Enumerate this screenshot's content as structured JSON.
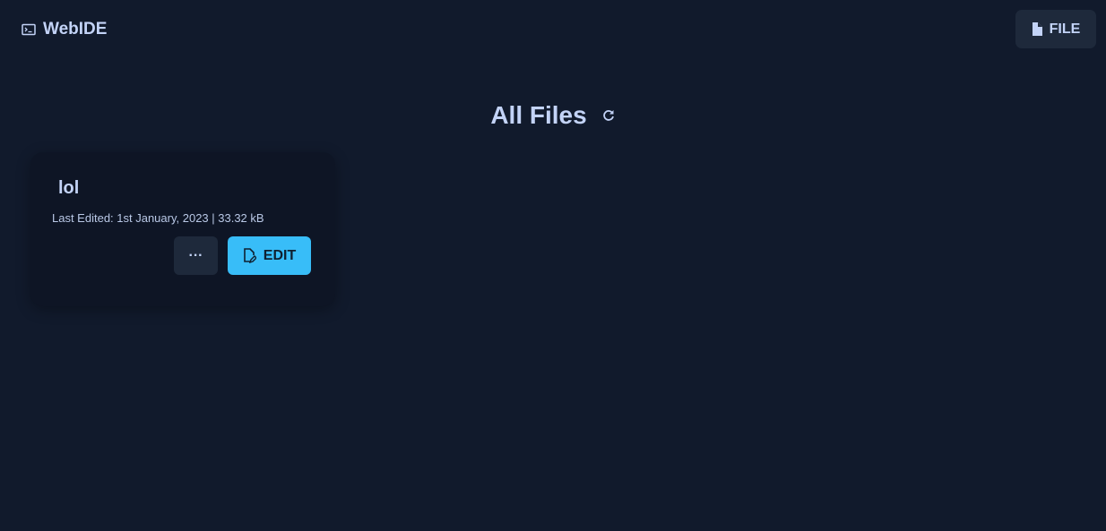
{
  "header": {
    "app_title": "WebIDE",
    "file_button": "FILE"
  },
  "main": {
    "title": "All Files",
    "files": [
      {
        "name": "lol",
        "meta": "Last Edited: 1st January, 2023 | 33.32 kB",
        "more_label": "···",
        "edit_label": "EDIT"
      }
    ]
  }
}
